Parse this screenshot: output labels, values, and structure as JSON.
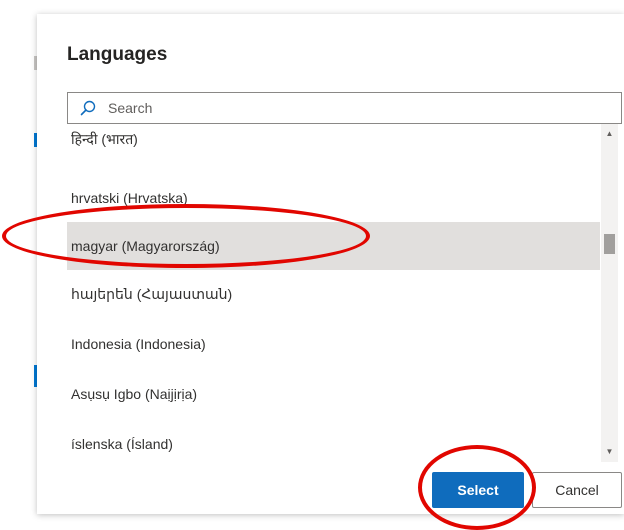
{
  "dialog": {
    "title": "Languages",
    "search": {
      "placeholder": "Search",
      "value": ""
    },
    "items": [
      {
        "label": "हिन्दी (भारत)",
        "selected": false
      },
      {
        "label": "hrvatski (Hrvatska)",
        "selected": false
      },
      {
        "label": "magyar (Magyarország)",
        "selected": true
      },
      {
        "label": "հայերեն (Հայաստան)",
        "selected": false
      },
      {
        "label": "Indonesia (Indonesia)",
        "selected": false
      },
      {
        "label": "Asụsụ Igbo (Naịjịrịa)",
        "selected": false
      },
      {
        "label": "íslenska (Ísland)",
        "selected": false
      }
    ],
    "buttons": {
      "select": "Select",
      "cancel": "Cancel"
    }
  },
  "icons": {
    "search": "search-icon",
    "scroll_up": "chevron-up-icon",
    "scroll_down": "chevron-down-icon"
  },
  "colors": {
    "accent": "#0f6cbd",
    "selected_row": "#e1dfdd",
    "annotation": "#e10600"
  }
}
